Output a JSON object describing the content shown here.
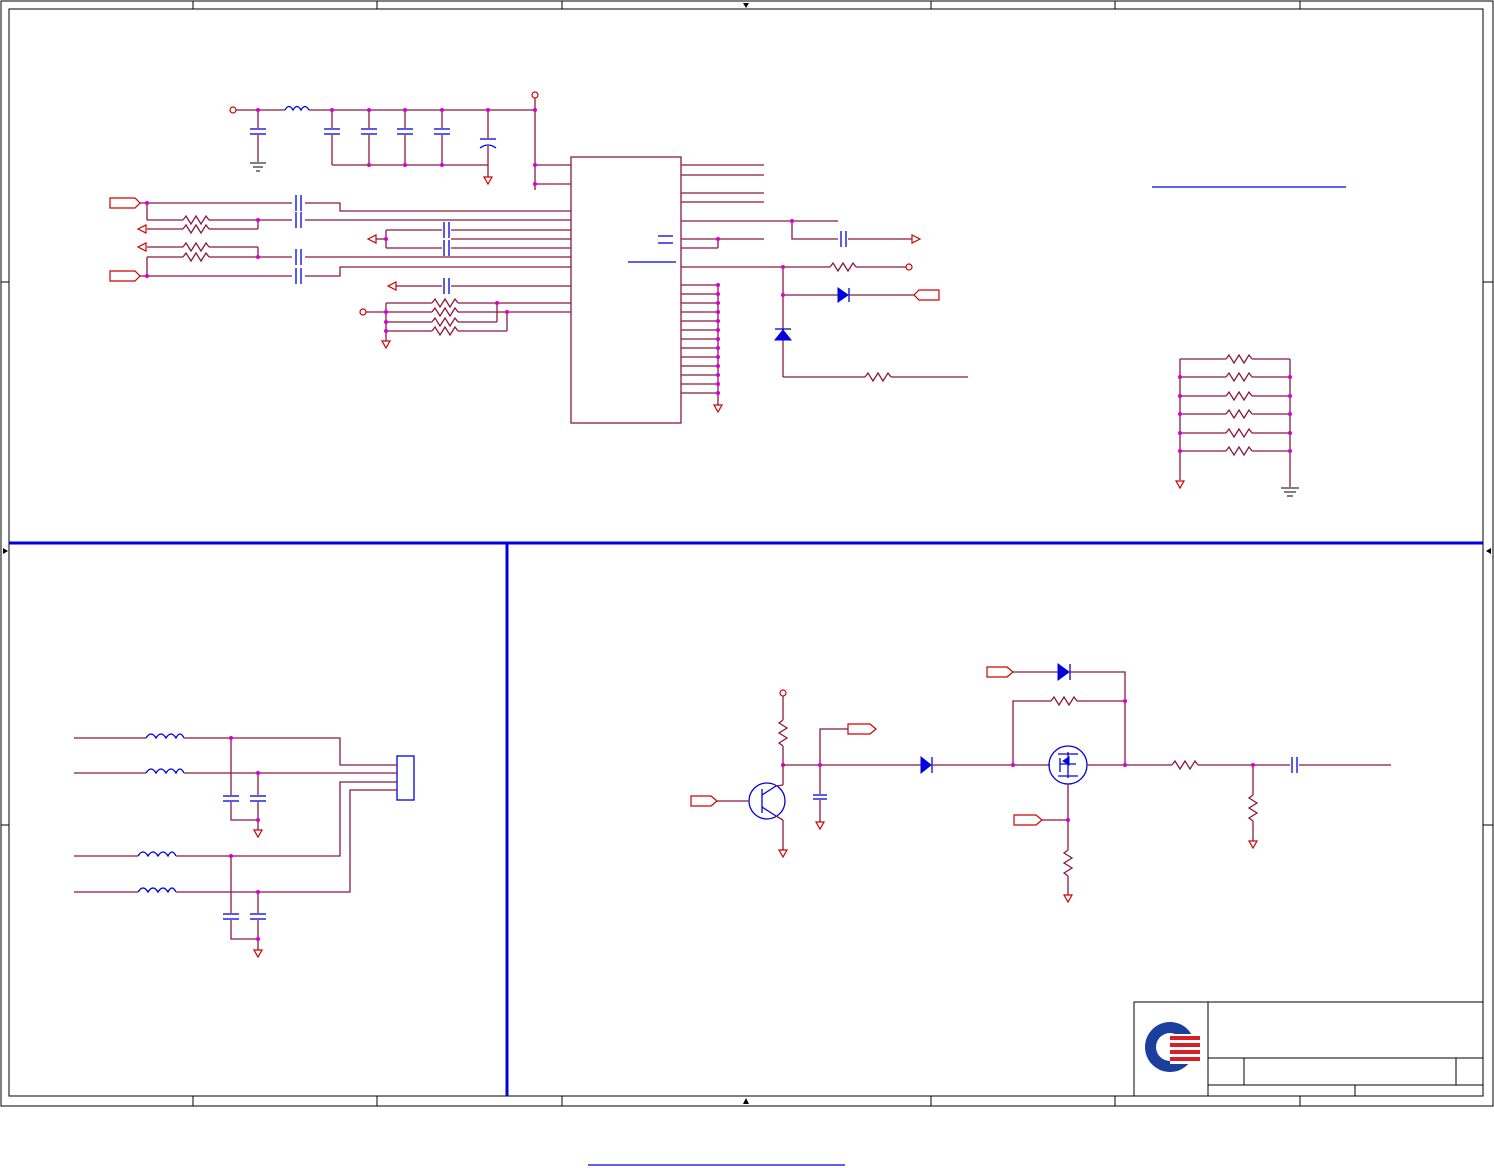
{
  "sheet": {
    "palette": {
      "wire": "#8b1a3c",
      "symbol": "#0000e0",
      "net_port": "#d00000",
      "junction": "#d600d6",
      "frame": "#000000",
      "section_divider": "#0000e0",
      "logo_blue": "#1b3f9c",
      "logo_red": "#d61f26"
    },
    "title_block": {
      "logo": "company-logo"
    }
  }
}
